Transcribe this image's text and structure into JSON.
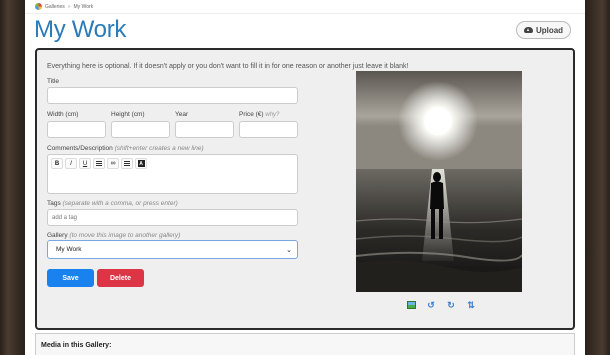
{
  "breadcrumb": {
    "root": "Galleries",
    "separator": "»",
    "current": "My Work"
  },
  "page_title": "My Work",
  "upload_label": "Upload",
  "form": {
    "note": "Everything here is optional. If it doesn't apply or you don't want to fill it in for one reason or another just leave it blank!",
    "title_label": "Title",
    "title_value": "",
    "width_label": "Width (cm)",
    "height_label": "Height (cm)",
    "year_label": "Year",
    "price_label": "Price (€)",
    "price_why": "why?",
    "comments_label": "Comments/Description",
    "comments_hint": "(shift+enter creates a new line)",
    "toolbar": {
      "bold": "B",
      "italic": "I",
      "underline": "U"
    },
    "tags_label": "Tags",
    "tags_hint": "(separate with a comma, or press enter)",
    "tags_placeholder": "add a tag",
    "gallery_label": "Gallery",
    "gallery_hint": "(to move this image to another gallery)",
    "gallery_selected": "My Work",
    "save_label": "Save",
    "delete_label": "Delete"
  },
  "photo_controls": [
    "image-icon",
    "rotate-left-icon",
    "rotate-right-icon",
    "flip-icon"
  ],
  "media_heading": "Media in this Gallery:",
  "colors": {
    "title": "#2b7bb9",
    "save": "#1a82ee",
    "delete": "#dc3545"
  }
}
